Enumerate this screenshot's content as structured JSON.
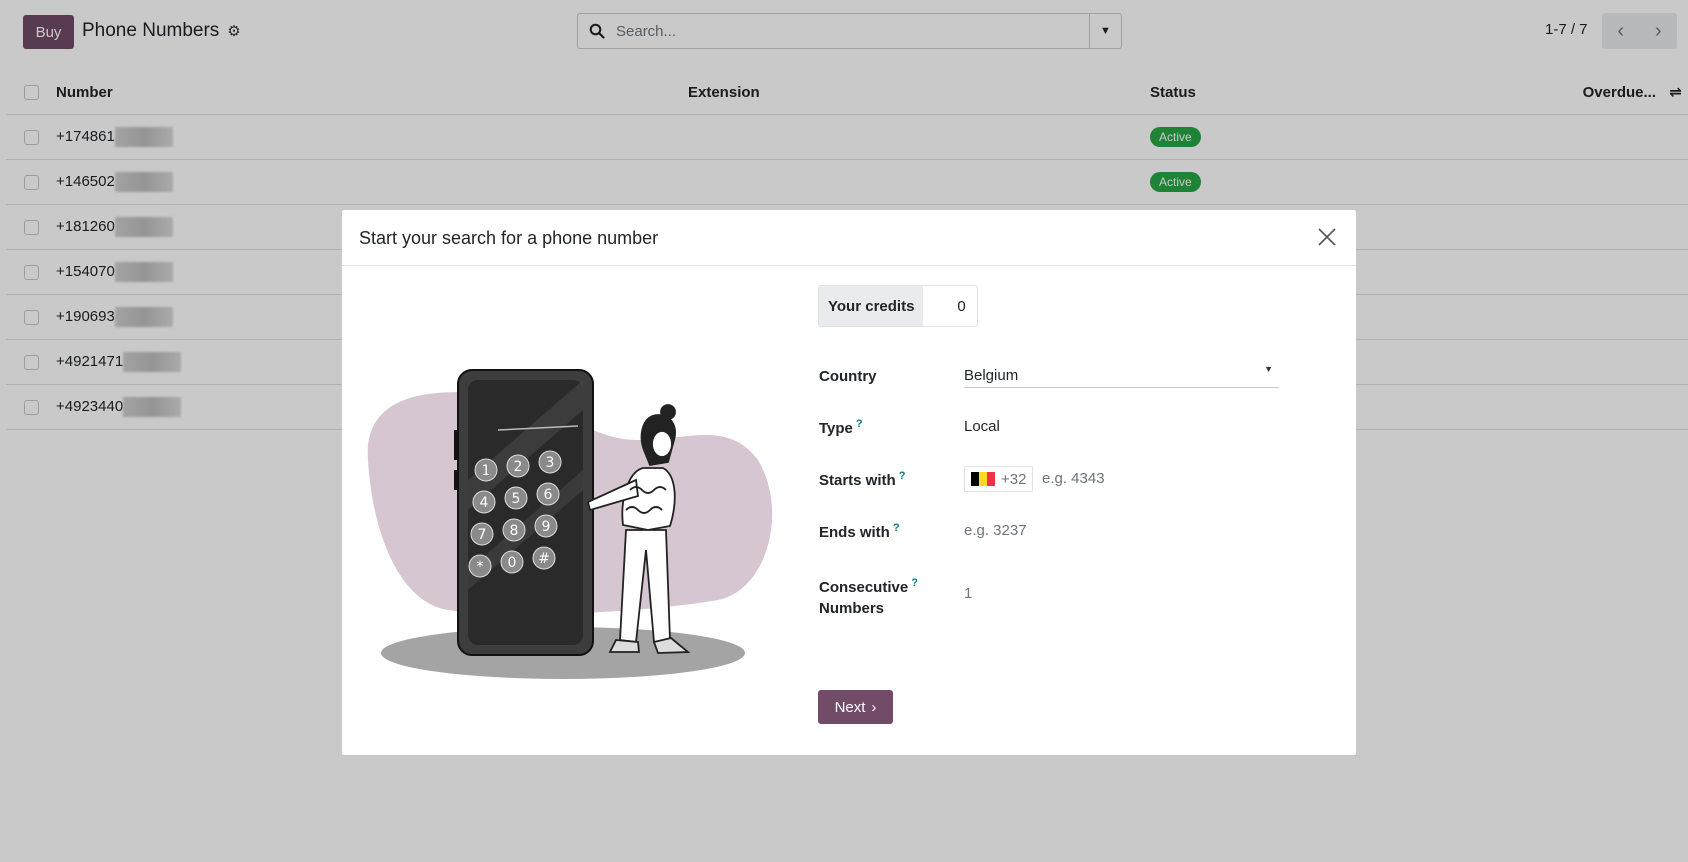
{
  "control_panel": {
    "buy_label": "Buy",
    "title": "Phone Numbers",
    "search_placeholder": "Search...",
    "pager_value": "1-7 / 7"
  },
  "list": {
    "columns": {
      "number": "Number",
      "extension": "Extension",
      "status": "Status",
      "overdue": "Overdue..."
    },
    "rows": [
      {
        "number": "+174861",
        "status": "Active"
      },
      {
        "number": "+146502",
        "status": "Active"
      },
      {
        "number": "+181260",
        "status": ""
      },
      {
        "number": "+154070",
        "status": ""
      },
      {
        "number": "+190693",
        "status": ""
      },
      {
        "number": "+4921471",
        "status": ""
      },
      {
        "number": "+4923440",
        "status": ""
      }
    ]
  },
  "modal": {
    "title": "Start your search for a phone number",
    "credits_label": "Your credits",
    "credits_value": "0",
    "country_label": "Country",
    "country_value": "Belgium",
    "type_label": "Type",
    "type_value": "Local",
    "starts_label": "Starts with",
    "starts_prefix": "+32",
    "starts_placeholder": "e.g. 4343",
    "ends_label": "Ends with",
    "ends_placeholder": "e.g. 3237",
    "consecutive_label_1": "Consecutive",
    "consecutive_label_2": "Numbers",
    "consecutive_value": "1",
    "help_mark": "?",
    "next_label": "Next",
    "keypad_keys": [
      "1",
      "2",
      "3",
      "4",
      "5",
      "6",
      "7",
      "8",
      "9",
      "*",
      "0",
      "#"
    ]
  },
  "colors": {
    "primary": "#714B67",
    "active_badge": "#28a745",
    "blob": "#d5c6d1",
    "help": "#017e84"
  },
  "icons": {
    "gear": "gear-icon",
    "search": "search-icon",
    "close": "close-icon",
    "caret": "caret-down-icon",
    "pager_prev": "chevron-left-icon",
    "pager_next": "chevron-right-icon",
    "optional_columns": "settings-adjust-icon",
    "next_arrow": "chevron-right-icon"
  }
}
